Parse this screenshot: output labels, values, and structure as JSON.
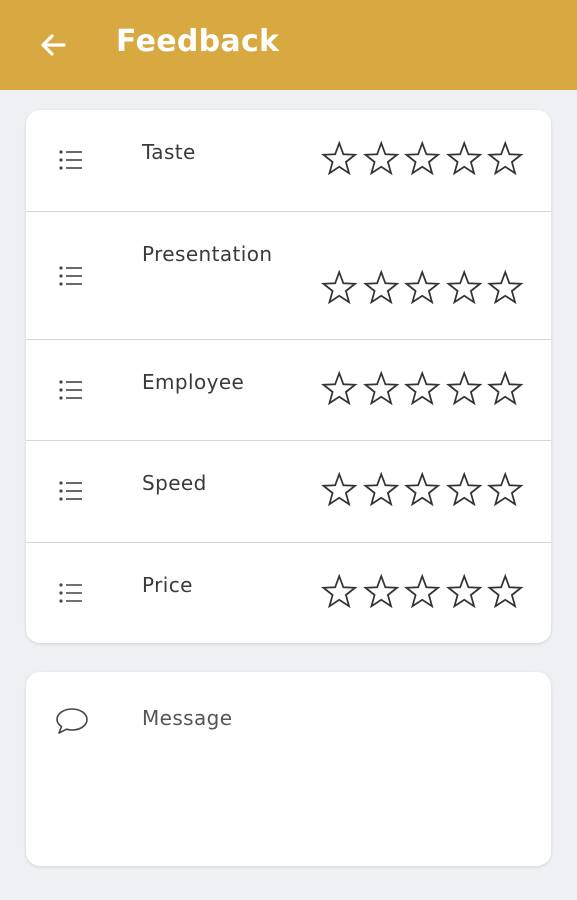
{
  "app_bar": {
    "title": "Feedback",
    "background": "#d9a941",
    "back_icon": "arrow-left-icon"
  },
  "ratings": [
    {
      "label": "Taste",
      "icon": "list-icon",
      "stars_max": 5,
      "stars_value": 0
    },
    {
      "label": "Presentation",
      "icon": "list-icon",
      "stars_max": 5,
      "stars_value": 0
    },
    {
      "label": "Employee",
      "icon": "list-icon",
      "stars_max": 5,
      "stars_value": 0
    },
    {
      "label": "Speed",
      "icon": "list-icon",
      "stars_max": 5,
      "stars_value": 0
    },
    {
      "label": "Price",
      "icon": "list-icon",
      "stars_max": 5,
      "stars_value": 0
    }
  ],
  "message": {
    "icon": "speech-bubble-icon",
    "placeholder": "Message",
    "value": ""
  }
}
